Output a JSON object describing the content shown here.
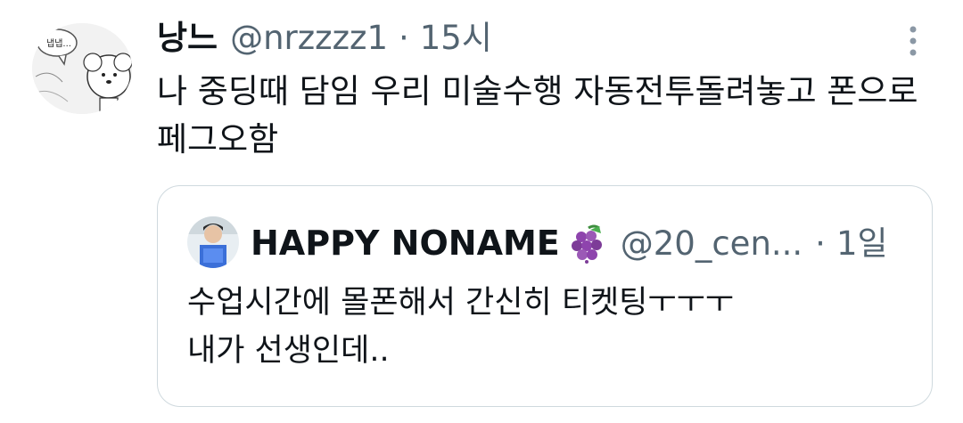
{
  "tweet": {
    "author_name": "낭느",
    "handle": "@nrzzzz1",
    "separator": "·",
    "time": "15시",
    "text_lines": [
      "나 중딩때 담임 우리 미술수행 자동전투돌려놓고 폰으로",
      "페그오함"
    ],
    "more_icon": "more-vertical-icon"
  },
  "quoted_tweet": {
    "author_name": "HAPPY NONAME",
    "emoji": "grapes-emoji",
    "handle": "@20_cen...",
    "separator": "·",
    "time": "1일",
    "text_lines": [
      "수업시간에 몰폰해서 간신히 티켓팅ㅜㅜㅜ",
      "내가 선생인데.."
    ]
  },
  "colors": {
    "text": "#0f1419",
    "secondary": "#536471",
    "border": "#cfd9de",
    "grape": "#8e44ad"
  }
}
